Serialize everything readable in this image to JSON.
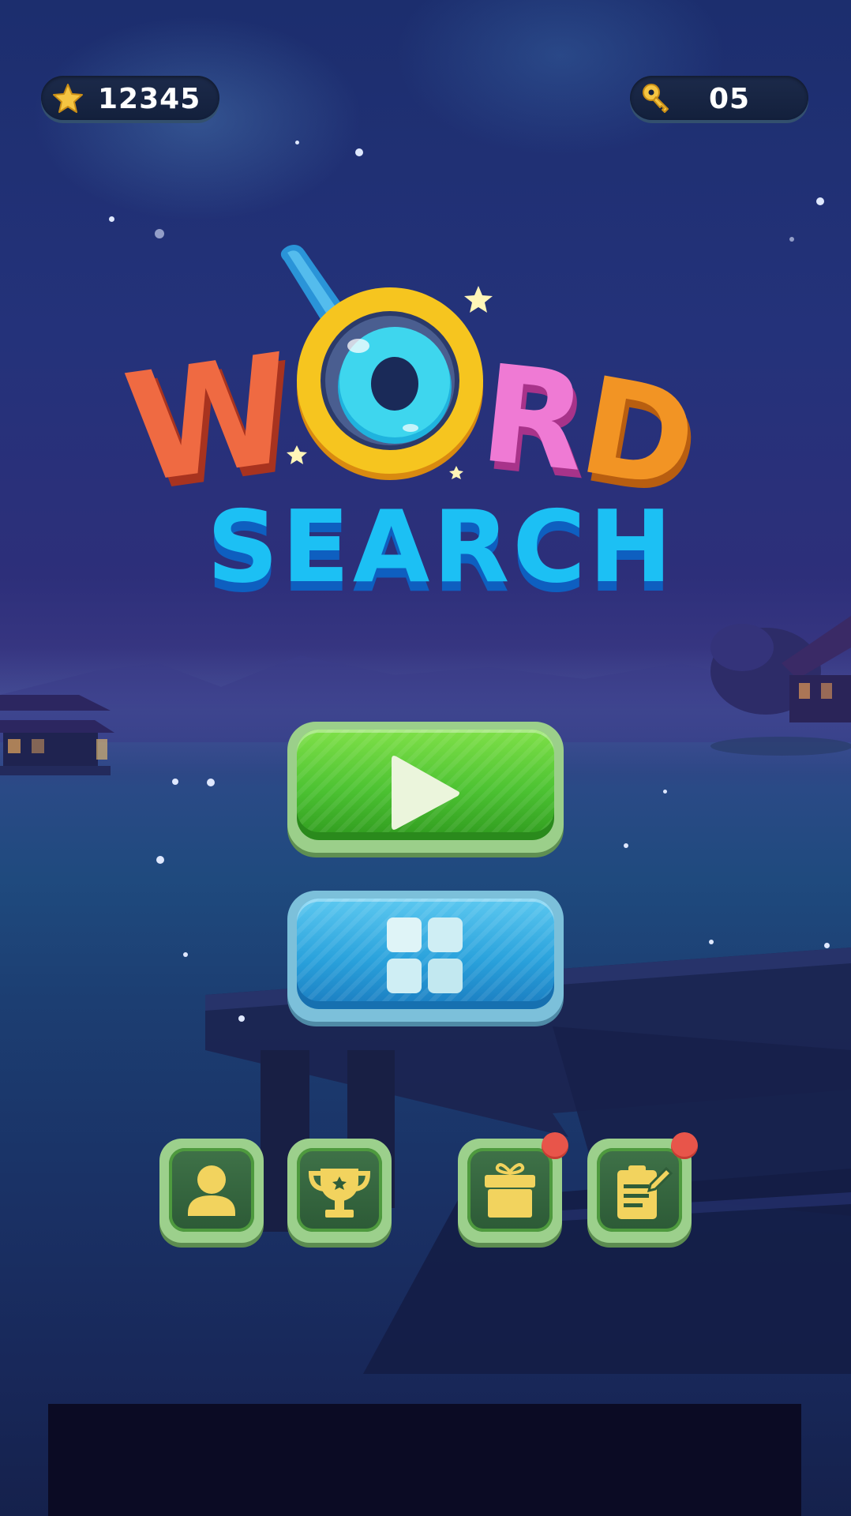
{
  "hud": {
    "coins": "12345",
    "coin_icon": "star-icon",
    "keys": "05",
    "key_icon": "key-icon"
  },
  "logo": {
    "line1": "WORD",
    "line2": "SEARCH",
    "colors": {
      "W": "#ef5a3a",
      "O": "#f2c21e",
      "R": "#e64fb8",
      "D": "#f08a1c",
      "search": "#14b8f0"
    }
  },
  "buttons": {
    "play_icon": "play-icon",
    "levels_icon": "grid-icon",
    "profile_icon": "user-icon",
    "trophy_icon": "trophy-icon",
    "gift_icon": "gift-icon",
    "tasks_icon": "notepad-edit-icon"
  },
  "colors": {
    "play_green": "#4cc232",
    "levels_blue": "#2aa2dc",
    "icon_gold": "#f2d35e",
    "notification_red": "#e8554a"
  }
}
